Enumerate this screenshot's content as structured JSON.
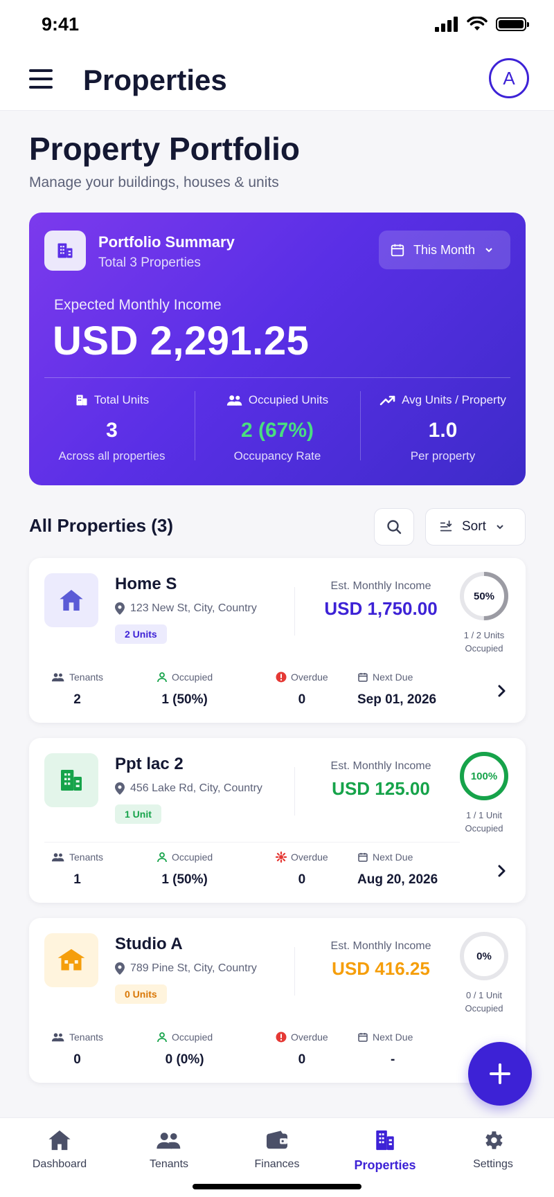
{
  "status_bar": {
    "time": "9:41"
  },
  "app_bar": {
    "title": "Properties",
    "avatar_initial": "A"
  },
  "header": {
    "title": "Property Portfolio",
    "subtitle": "Manage your buildings, houses & units"
  },
  "summary": {
    "title": "Portfolio Summary",
    "subtitle": "Total 3 Properties",
    "period_label": "This Month",
    "income_label": "Expected Monthly Income",
    "income_value": "USD 2,291.25",
    "stats": [
      {
        "label": "Total Units",
        "value": "3",
        "foot": "Across all properties",
        "icon": "building-icon"
      },
      {
        "label": "Occupied Units",
        "value": "2 (67%)",
        "foot": "Occupancy Rate",
        "icon": "users-icon"
      },
      {
        "label": "Avg Units / Property",
        "value": "1.0",
        "foot": "Per property",
        "icon": "trend-up-icon"
      }
    ]
  },
  "list": {
    "title": "All Properties (3)",
    "sort_label": "Sort"
  },
  "properties": [
    {
      "name": "Home S",
      "address": "123 New St, City, Country",
      "badge": "2 Units",
      "income_label": "Est. Monthly Income",
      "income_value": "USD 1,750.00",
      "occupancy_pct": 50,
      "ring_text": "50%",
      "ring_caption_1": "1 / 2 Units",
      "ring_caption_2": "Occupied",
      "accent": "#3d22d6",
      "metrics": {
        "tenants_label": "Tenants",
        "tenants": "2",
        "occupied_label": "Occupied",
        "occupied": "1 (50%)",
        "overdue_label": "Overdue",
        "overdue": "0",
        "next_due_label": "Next Due",
        "next_due": "Sep 01, 2026"
      }
    },
    {
      "name": "Ppt lac 2",
      "address": "456 Lake Rd, City, Country",
      "badge": "1 Unit",
      "income_label": "Est. Monthly Income",
      "income_value": "USD 125.00",
      "occupancy_pct": 100,
      "ring_text": "100%",
      "ring_caption_1": "1 / 1 Unit",
      "ring_caption_2": "Occupied",
      "accent": "#16a34a",
      "metrics": {
        "tenants_label": "Tenants",
        "tenants": "1",
        "occupied_label": "Occupied",
        "occupied": "1 (50%)",
        "overdue_label": "Overdue",
        "overdue": "0",
        "next_due_label": "Next Due",
        "next_due": "Aug 20, 2026"
      }
    },
    {
      "name": "Studio A",
      "address": "789 Pine St, City, Country",
      "badge": "0 Units",
      "income_label": "Est. Monthly Income",
      "income_value": "USD 416.25",
      "occupancy_pct": 0,
      "ring_text": "0%",
      "ring_caption_1": "0 / 1 Unit",
      "ring_caption_2": "Occupied",
      "accent": "#f59e0b",
      "metrics": {
        "tenants_label": "Tenants",
        "tenants": "0",
        "occupied_label": "Occupied",
        "occupied": "0 (0%)",
        "overdue_label": "Overdue",
        "overdue": "0",
        "next_due_label": "Next Due",
        "next_due": "-"
      }
    }
  ],
  "nav": [
    {
      "label": "Dashboard",
      "icon": "home-icon"
    },
    {
      "label": "Tenants",
      "icon": "users-icon"
    },
    {
      "label": "Finances",
      "icon": "wallet-icon"
    },
    {
      "label": "Properties",
      "icon": "building-icon",
      "active": true
    },
    {
      "label": "Settings",
      "icon": "gear-icon"
    }
  ],
  "colors": {
    "primary": "#3d22d6",
    "success": "#16a34a",
    "warning": "#f59e0b",
    "danger": "#e53935"
  }
}
